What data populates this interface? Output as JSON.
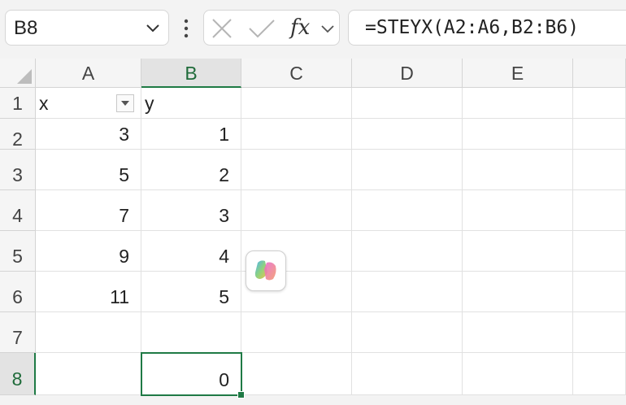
{
  "name_box": {
    "value": "B8"
  },
  "formula_bar": {
    "fx_label": "fx",
    "formula": "=STEYX(A2:A6,B2:B6)"
  },
  "columns": [
    {
      "label": "A",
      "selected": false
    },
    {
      "label": "B",
      "selected": true
    },
    {
      "label": "C",
      "selected": false
    },
    {
      "label": "D",
      "selected": false
    },
    {
      "label": "E",
      "selected": false
    }
  ],
  "rows": [
    {
      "label": "1",
      "selected": false,
      "cells": [
        {
          "value": "x",
          "type": "text",
          "filter": true
        },
        {
          "value": "y",
          "type": "text"
        }
      ]
    },
    {
      "label": "2",
      "selected": false,
      "cells": [
        {
          "value": "3",
          "type": "number"
        },
        {
          "value": "1",
          "type": "number"
        }
      ]
    },
    {
      "label": "3",
      "selected": false,
      "cells": [
        {
          "value": "5",
          "type": "number"
        },
        {
          "value": "2",
          "type": "number"
        }
      ]
    },
    {
      "label": "4",
      "selected": false,
      "cells": [
        {
          "value": "7",
          "type": "number"
        },
        {
          "value": "3",
          "type": "number"
        }
      ]
    },
    {
      "label": "5",
      "selected": false,
      "cells": [
        {
          "value": "9",
          "type": "number"
        },
        {
          "value": "4",
          "type": "number"
        }
      ]
    },
    {
      "label": "6",
      "selected": false,
      "cells": [
        {
          "value": "11",
          "type": "number"
        },
        {
          "value": "5",
          "type": "number"
        }
      ]
    },
    {
      "label": "7",
      "selected": false,
      "cells": [
        {
          "value": "",
          "type": "text"
        },
        {
          "value": "",
          "type": "text"
        }
      ]
    },
    {
      "label": "8",
      "selected": true,
      "cells": [
        {
          "value": "",
          "type": "text"
        },
        {
          "value": "0",
          "type": "number"
        }
      ]
    }
  ],
  "colors": {
    "accent": "#1f7a45",
    "header_bg": "#f5f5f5",
    "gridline": "#e1e1e1"
  },
  "icons": {
    "copilot": "copilot-icon"
  }
}
